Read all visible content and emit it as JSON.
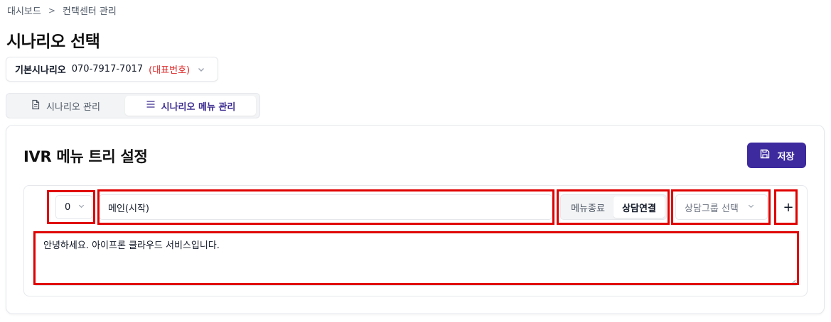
{
  "breadcrumb": {
    "items": [
      "대시보드",
      "컨택센터 관리"
    ],
    "separator": ">"
  },
  "page": {
    "title": "시나리오 선택"
  },
  "scenario_select": {
    "name": "기본시나리오",
    "phone": "070-7917-7017",
    "tag": "(대표번호)",
    "icon": "chevron-down-icon"
  },
  "tabs": [
    {
      "label": "시나리오 관리",
      "icon": "document-icon",
      "active": false
    },
    {
      "label": "시나리오 메뉴 관리",
      "icon": "menu-list-icon",
      "active": true
    }
  ],
  "card": {
    "title": "IVR 메뉴 트리 설정",
    "save_label": "저장",
    "save_icon": "save-icon"
  },
  "menu_row": {
    "key_value": "0",
    "name_value": "메인(시작)",
    "mode_options": [
      "메뉴종료",
      "상담연결"
    ],
    "mode_selected": "상담연결",
    "group_placeholder": "상담그룹 선택",
    "add_label": "+",
    "message": "안녕하세요. 아이프론 클라우드 서비스입니다."
  },
  "colors": {
    "accent": "#3c2a9e",
    "tag_red": "#dc2626",
    "highlight": "#e00000",
    "border": "#e5e7eb"
  }
}
